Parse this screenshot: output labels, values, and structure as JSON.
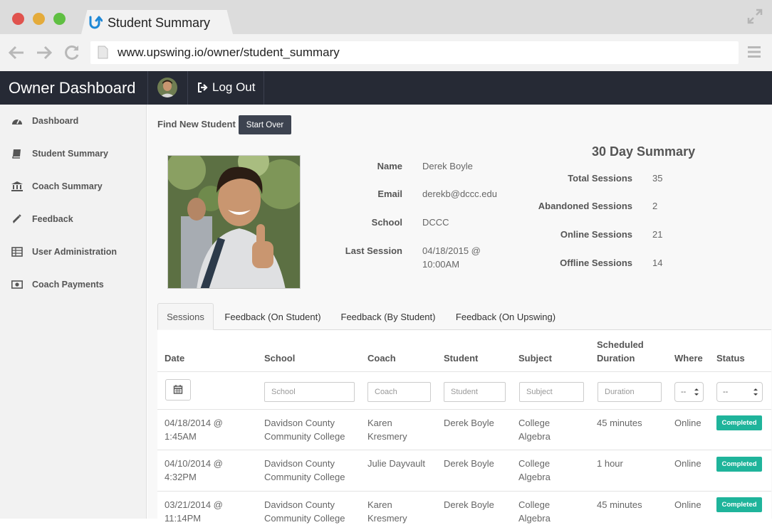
{
  "browser": {
    "tab_title": "Student Summary",
    "url": "www.upswing.io/owner/student_summary",
    "colors": {
      "close": "#e0534e",
      "minimize": "#e4ab3b",
      "maximize": "#5fbf42"
    }
  },
  "header": {
    "brand": "Owner Dashboard",
    "logout_label": "Log Out"
  },
  "sidebar": {
    "items": [
      {
        "label": "Dashboard",
        "icon": "dashboard-icon"
      },
      {
        "label": "Student Summary",
        "icon": "book-icon"
      },
      {
        "label": "Coach Summary",
        "icon": "bank-icon"
      },
      {
        "label": "Feedback",
        "icon": "pencil-icon"
      },
      {
        "label": "User Administration",
        "icon": "table-icon"
      },
      {
        "label": "Coach Payments",
        "icon": "money-icon"
      }
    ]
  },
  "main": {
    "find_label": "Find New Student",
    "start_over_label": "Start Over",
    "student": {
      "name_label": "Name",
      "name": "Derek Boyle",
      "email_label": "Email",
      "email": "derekb@dccc.edu",
      "school_label": "School",
      "school": "DCCC",
      "last_session_label": "Last Session",
      "last_session_line1": "04/18/2015 @",
      "last_session_line2": "10:00AM"
    },
    "summary": {
      "title": "30 Day Summary",
      "rows": [
        {
          "label": "Total Sessions",
          "value": "35"
        },
        {
          "label": "Abandoned Sessions",
          "value": "2"
        },
        {
          "label": "Online Sessions",
          "value": "21"
        },
        {
          "label": "Offline Sessions",
          "value": "14"
        }
      ]
    },
    "tabs": [
      {
        "label": "Sessions",
        "active": true
      },
      {
        "label": "Feedback (On Student)"
      },
      {
        "label": "Feedback (By Student)"
      },
      {
        "label": "Feedback (On Upswing)"
      }
    ],
    "table": {
      "headers": {
        "date": "Date",
        "school": "School",
        "coach": "Coach",
        "student": "Student",
        "subject": "Subject",
        "duration1": "Scheduled",
        "duration2": "Duration",
        "where": "Where",
        "status": "Status"
      },
      "filters": {
        "school": "School",
        "coach": "Coach",
        "student": "Student",
        "subject": "Subject",
        "duration": "Duration",
        "where": "--",
        "status": "--"
      },
      "rows": [
        {
          "date1": "04/18/2014 @",
          "date2": "1:45AM",
          "school1": "Davidson County",
          "school2": "Community College",
          "coach1": "Karen",
          "coach2": "Kresmery",
          "student": "Derek Boyle",
          "subject1": "College",
          "subject2": "Algebra",
          "duration": "45 minutes",
          "where": "Online",
          "status": "Completed"
        },
        {
          "date1": "04/10/2014 @",
          "date2": "4:32PM",
          "school1": "Davidson County",
          "school2": "Community College",
          "coach1": "Julie Dayvault",
          "coach2": "",
          "student": "Derek Boyle",
          "subject1": "College",
          "subject2": "Algebra",
          "duration": "1 hour",
          "where": "Online",
          "status": "Completed"
        },
        {
          "date1": "03/21/2014 @",
          "date2": "11:14PM",
          "school1": "Davidson County",
          "school2": "Community College",
          "coach1": "Karen",
          "coach2": "Kresmery",
          "student": "Derek Boyle",
          "subject1": "College",
          "subject2": "Algebra",
          "duration": "45 minutes",
          "where": "Online",
          "status": "Completed"
        }
      ]
    }
  }
}
